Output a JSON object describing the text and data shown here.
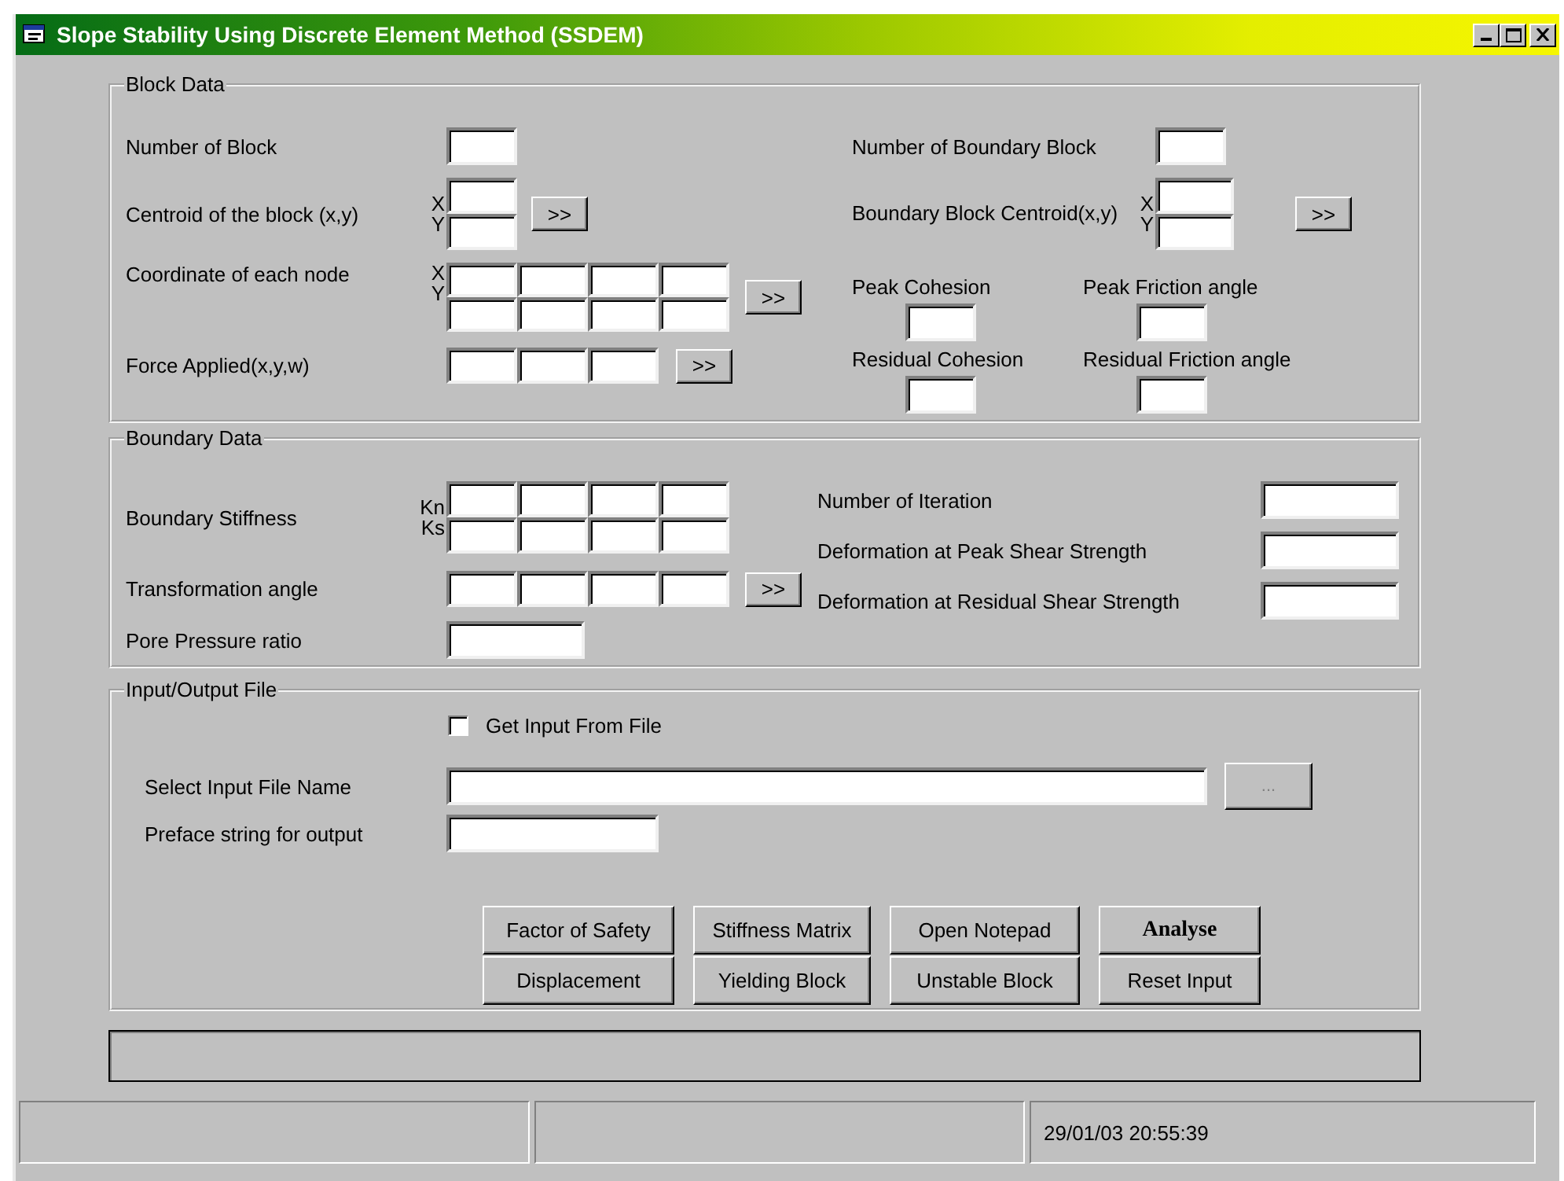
{
  "window": {
    "title": "Slope Stability Using Discrete Element Method (SSDEM)"
  },
  "block_data": {
    "title": "Block Data",
    "number_of_block": {
      "label": "Number of Block"
    },
    "centroid": {
      "label": "Centroid of the block (x,y)",
      "axes": [
        "X",
        "Y"
      ],
      "button": ">>"
    },
    "node_coordinates": {
      "label": "Coordinate of each node",
      "axes": [
        "X",
        "Y"
      ],
      "button": ">>"
    },
    "force_applied": {
      "label": "Force Applied(x,y,w)",
      "button": ">>"
    },
    "number_of_boundary_block": {
      "label": "Number of Boundary Block"
    },
    "boundary_block_centroid": {
      "label": "Boundary Block Centroid(x,y)",
      "axes": [
        "X",
        "Y"
      ],
      "button": ">>"
    },
    "strength": [
      {
        "label": "Peak Cohesion"
      },
      {
        "label": "Peak Friction angle"
      },
      {
        "label": "Residual Cohesion"
      },
      {
        "label": "Residual Friction angle"
      }
    ]
  },
  "boundary_data": {
    "title": "Boundary Data",
    "boundary_stiffness": {
      "label": "Boundary Stiffness",
      "axes": [
        "Kn",
        "Ks"
      ]
    },
    "transformation_angle": {
      "label": "Transformation angle",
      "button": ">>"
    },
    "pore_pressure_ratio": {
      "label": "Pore Pressure ratio"
    },
    "settings": [
      {
        "label": "Number of Iteration"
      },
      {
        "label": "Deformation at Peak Shear Strength"
      },
      {
        "label": "Deformation at Residual Shear Strength"
      }
    ]
  },
  "io_file": {
    "title": "Input/Output File",
    "get_input_from_file": {
      "label": "Get Input From File",
      "checked": false
    },
    "input_file_name": {
      "label": "Select Input  File Name",
      "button": "..."
    },
    "preface_string": {
      "label": "Preface string for output"
    },
    "buttons": [
      {
        "label": "Factor of Safety",
        "kind": "normal"
      },
      {
        "label": "Stiffness Matrix",
        "kind": "normal"
      },
      {
        "label": "Open Notepad",
        "kind": "normal"
      },
      {
        "label": "Analyse",
        "kind": "default"
      },
      {
        "label": "Displacement",
        "kind": "normal"
      },
      {
        "label": "Yielding Block",
        "kind": "normal"
      },
      {
        "label": "Unstable Block",
        "kind": "normal"
      },
      {
        "label": "Reset Input",
        "kind": "normal"
      }
    ]
  },
  "status_bar": {
    "datetime": "29/01/03 20:55:39"
  }
}
